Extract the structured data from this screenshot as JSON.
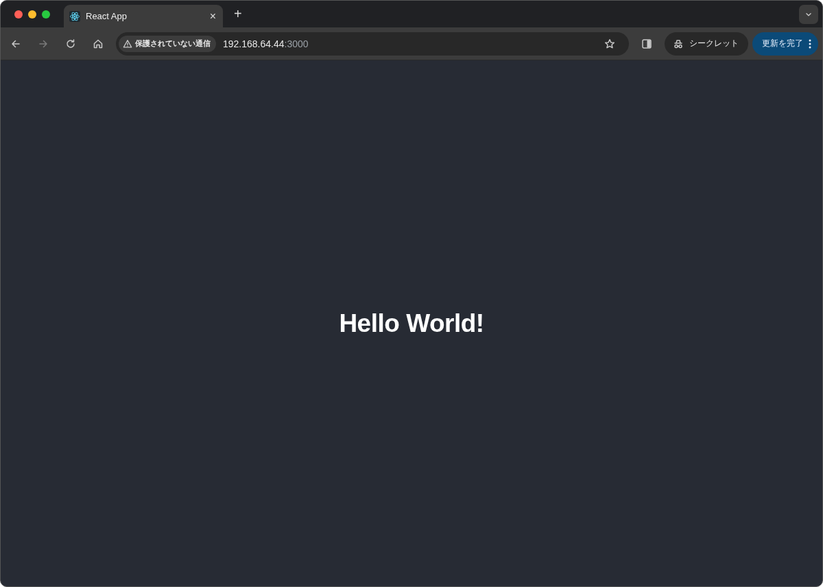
{
  "tabs": [
    {
      "title": "React App",
      "selected": true,
      "close": "×"
    }
  ],
  "new_tab": "+",
  "address_bar": {
    "security_label": "保護されていない通信",
    "host": "192.168.64.44",
    "port": ":3000"
  },
  "incognito": {
    "label": "シークレット"
  },
  "update_button": {
    "label": "更新を完了"
  },
  "page": {
    "heading": "Hello World!"
  }
}
